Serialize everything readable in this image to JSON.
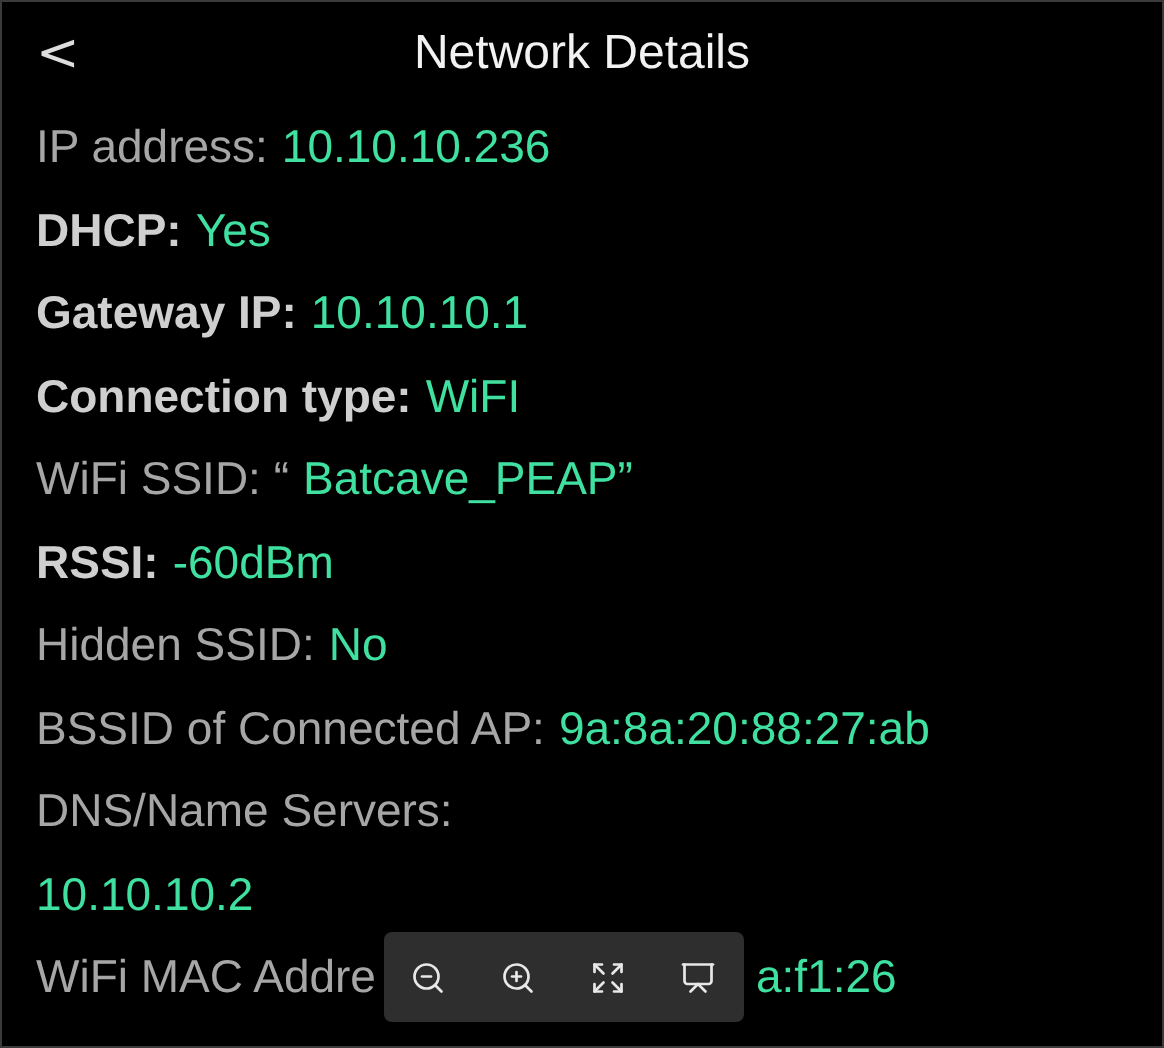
{
  "header": {
    "back": "<",
    "title": "Network Details"
  },
  "rows": [
    {
      "label": "IP address:",
      "value": "10.10.10.236",
      "bold": false
    },
    {
      "label": "DHCP:",
      "value": "Yes",
      "bold": true
    },
    {
      "label": "Gateway IP:",
      "value": "10.10.10.1",
      "bold": true
    },
    {
      "label": "Connection type:",
      "value": "WiFI",
      "bold": true
    },
    {
      "label": "WiFi SSID: “",
      "value": "Batcave_PEAP”",
      "bold": false
    },
    {
      "label": "RSSI:",
      "value": "-60dBm",
      "bold": true
    },
    {
      "label": "Hidden SSID:",
      "value": "No",
      "bold": false
    },
    {
      "label": "BSSID of Connected AP:",
      "value": "9a:8a:20:88:27:ab",
      "bold": false
    },
    {
      "label": "DNS/Name Servers:",
      "bold": false
    },
    {
      "value": "10.10.10.2"
    }
  ],
  "covered_row": {
    "label": "WiFi MAC Addre",
    "value": "a:f1:26"
  },
  "viewer_toolbar": {
    "buttons": [
      {
        "kind": "zoom-out"
      },
      {
        "kind": "zoom-in"
      },
      {
        "kind": "fit"
      },
      {
        "kind": "slideshow"
      }
    ]
  }
}
